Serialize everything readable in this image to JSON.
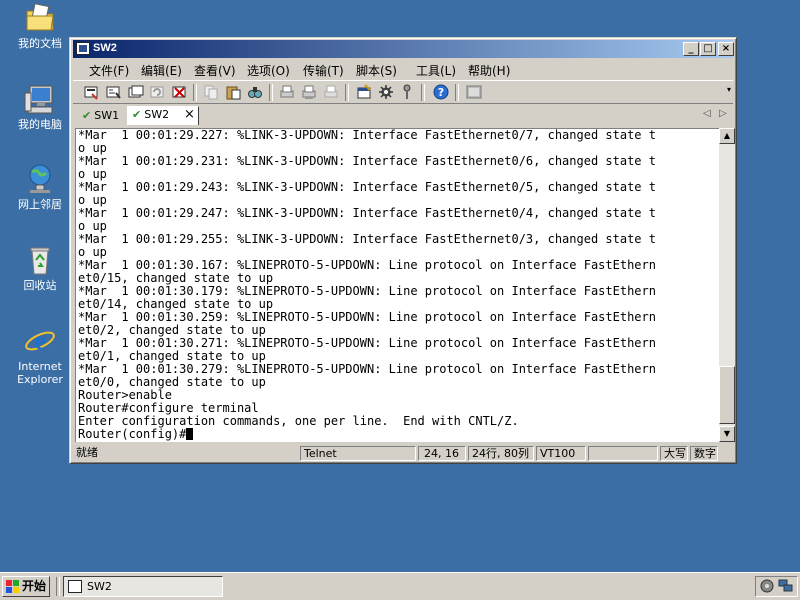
{
  "desktop": {
    "icons": [
      {
        "label": "我的文档",
        "icon": "my-documents-icon"
      },
      {
        "label": "我的电脑",
        "icon": "my-computer-icon"
      },
      {
        "label": "网上邻居",
        "icon": "network-places-icon"
      },
      {
        "label": "回收站",
        "icon": "recycle-bin-icon"
      },
      {
        "label": "Internet Explorer",
        "icon": "internet-explorer-icon"
      }
    ]
  },
  "window": {
    "title": "SW2",
    "controls": {
      "minimize": "_",
      "maximize": "□",
      "close": "×"
    },
    "menu": [
      "文件(F)",
      "编辑(E)",
      "查看(V)",
      "选项(O)",
      "传输(T)",
      "脚本(S)",
      "工具(L)",
      "帮助(H)"
    ],
    "toolbar": [
      "connect-icon",
      "quick-connect-icon",
      "connect-tab-icon",
      "reconnect-icon",
      "disconnect-icon",
      "copy-icon",
      "paste-icon",
      "find-icon",
      "print-icon",
      "print-setup-icon",
      "print-screen-icon",
      "session-options-icon",
      "global-options-icon",
      "keymap-icon",
      "help-icon",
      "sftp-icon"
    ],
    "tabs": [
      {
        "label": "SW1",
        "active": false
      },
      {
        "label": "SW2",
        "active": true
      }
    ],
    "tab_close": "×",
    "tab_nav": {
      "prev": "◁",
      "next": "▷"
    },
    "terminal": {
      "lines": [
        "*Mar  1 00:01:29.227: %LINK-3-UPDOWN: Interface FastEthernet0/7, changed state t",
        "o up",
        "*Mar  1 00:01:29.231: %LINK-3-UPDOWN: Interface FastEthernet0/6, changed state t",
        "o up",
        "*Mar  1 00:01:29.243: %LINK-3-UPDOWN: Interface FastEthernet0/5, changed state t",
        "o up",
        "*Mar  1 00:01:29.247: %LINK-3-UPDOWN: Interface FastEthernet0/4, changed state t",
        "o up",
        "*Mar  1 00:01:29.255: %LINK-3-UPDOWN: Interface FastEthernet0/3, changed state t",
        "o up",
        "*Mar  1 00:01:30.167: %LINEPROTO-5-UPDOWN: Line protocol on Interface FastEthern",
        "et0/15, changed state to up",
        "*Mar  1 00:01:30.179: %LINEPROTO-5-UPDOWN: Line protocol on Interface FastEthern",
        "et0/14, changed state to up",
        "*Mar  1 00:01:30.259: %LINEPROTO-5-UPDOWN: Line protocol on Interface FastEthern",
        "et0/2, changed state to up",
        "*Mar  1 00:01:30.271: %LINEPROTO-5-UPDOWN: Line protocol on Interface FastEthern",
        "et0/1, changed state to up",
        "*Mar  1 00:01:30.279: %LINEPROTO-5-UPDOWN: Line protocol on Interface FastEthern",
        "et0/0, changed state to up",
        "Router>enable",
        "Router#configure terminal",
        "Enter configuration commands, one per line.  End with CNTL/Z."
      ],
      "prompt": "Router(config)#"
    },
    "status": {
      "ready": "就绪",
      "protocol": "Telnet",
      "cursor_pos": "24, 16",
      "dimensions": "24行, 80列",
      "emulation": "VT100",
      "blank": "",
      "caps": "大写",
      "num": "数字"
    }
  },
  "taskbar": {
    "start": "开始",
    "task_title": "SW2",
    "tray_icons": [
      "volume-icon",
      "network-icon"
    ]
  }
}
